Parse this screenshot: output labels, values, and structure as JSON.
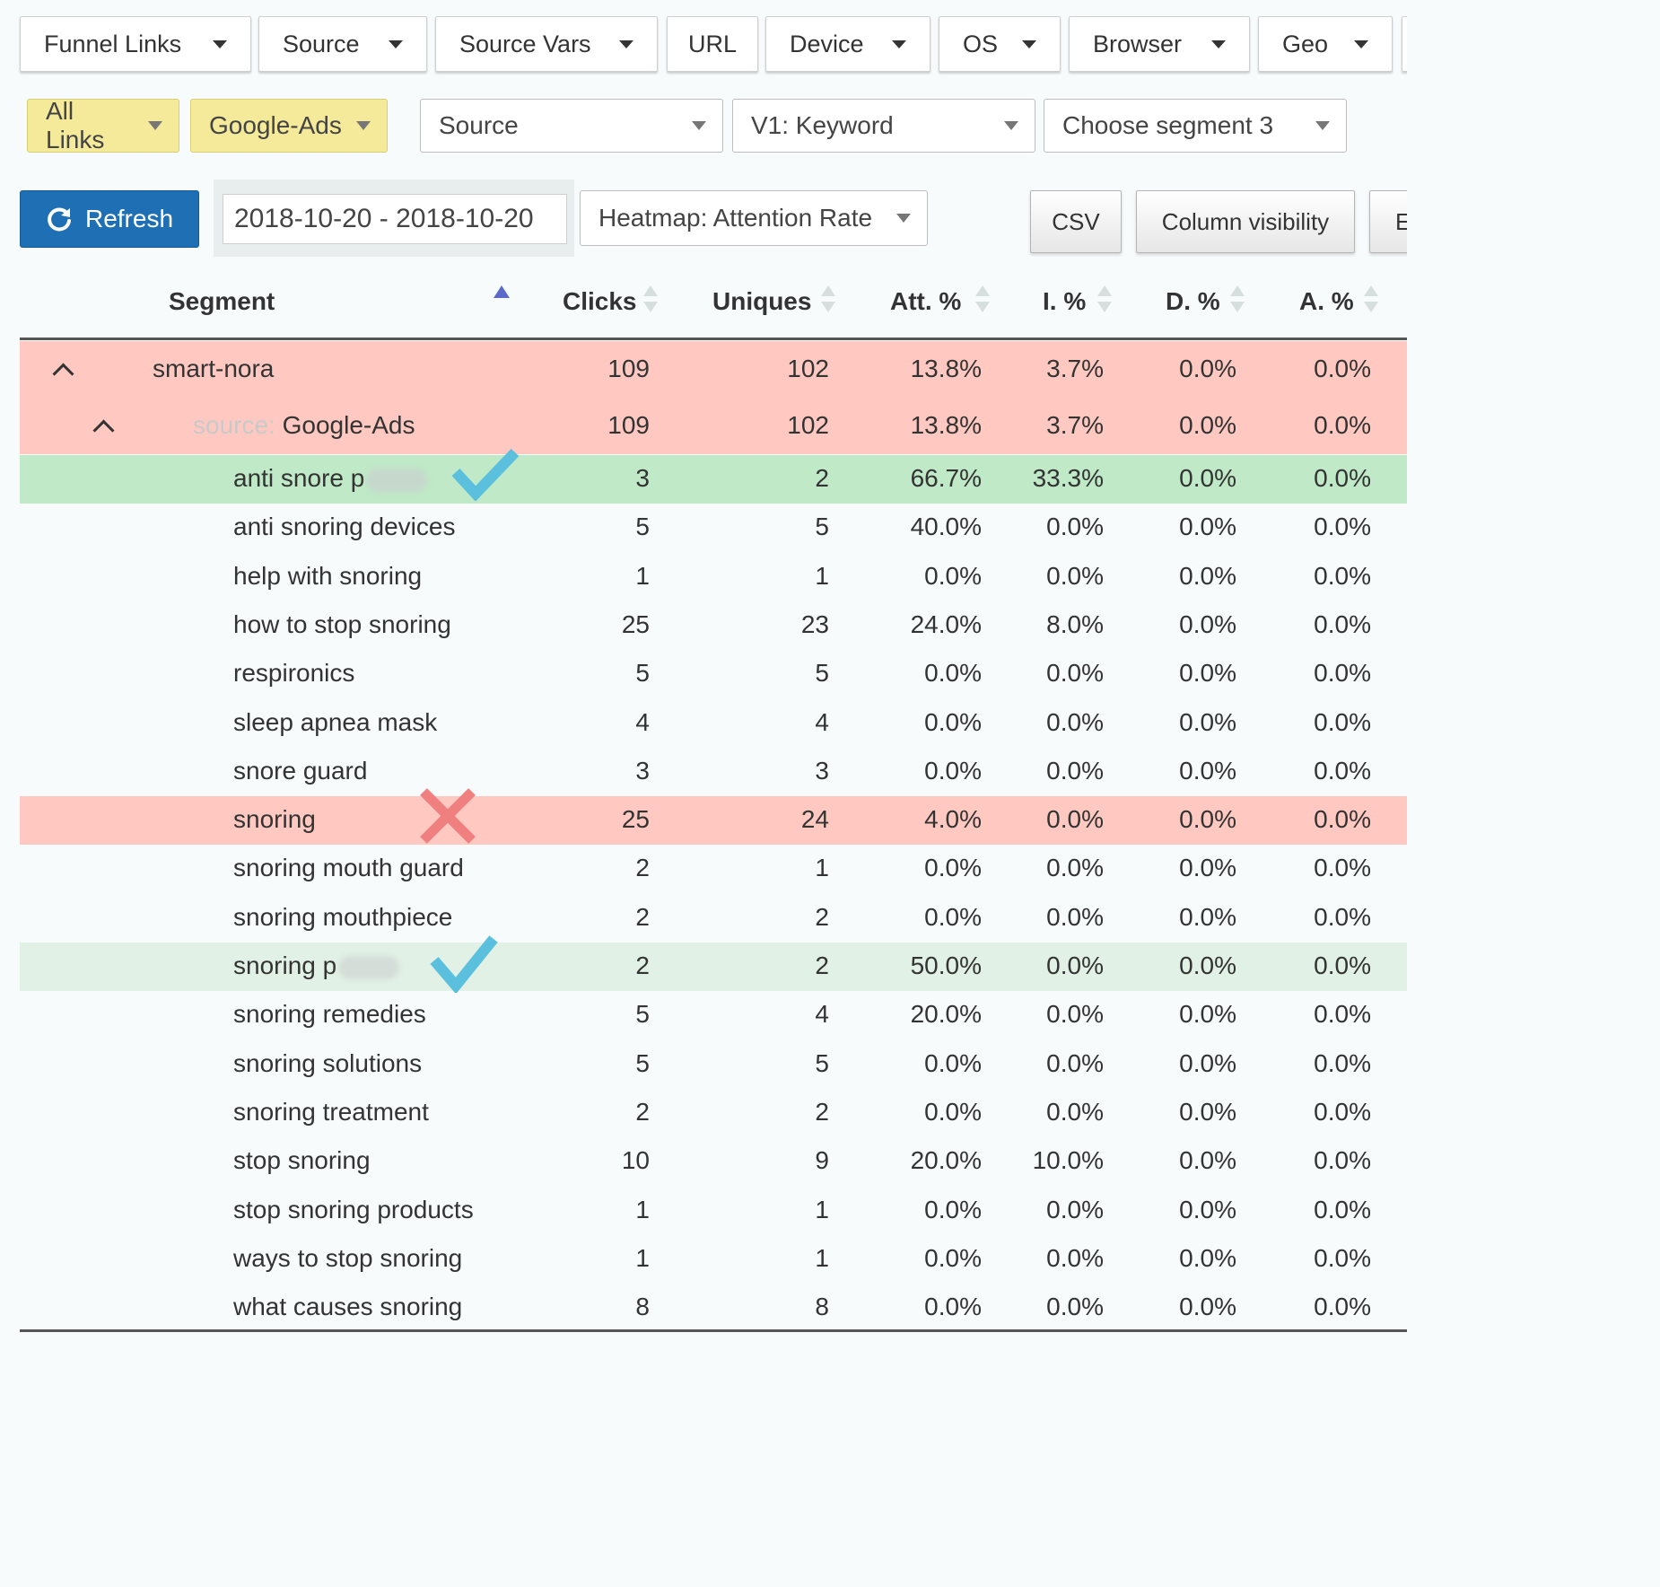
{
  "tabs": [
    {
      "label": "Funnel Links",
      "caret": true
    },
    {
      "label": "Source",
      "caret": true
    },
    {
      "label": "Source Vars",
      "caret": true
    },
    {
      "label": "URL",
      "caret": false
    },
    {
      "label": "Device",
      "caret": true
    },
    {
      "label": "OS",
      "caret": true
    },
    {
      "label": "Browser",
      "caret": true
    },
    {
      "label": "Geo",
      "caret": true
    }
  ],
  "segments": {
    "all_links": "All Links",
    "google_ads": "Google-Ads",
    "segment1": "Source",
    "segment2": "V1: Keyword",
    "segment3": "Choose segment 3"
  },
  "toolbar": {
    "refresh_label": "Refresh",
    "date_range": "2018-10-20 - 2018-10-20",
    "heatmap_label": "Heatmap: Attention Rate",
    "csv_label": "CSV",
    "column_visibility_label": "Column visibility",
    "cut_button_label": "E"
  },
  "table": {
    "columns": [
      "Segment",
      "Clicks",
      "Uniques",
      "Att. %",
      "I. %",
      "D. %",
      "A. %"
    ],
    "group_row": {
      "segment": "smart-nora",
      "clicks": "109",
      "uniques": "102",
      "att": "13.8%",
      "i": "3.7%",
      "d": "0.0%",
      "a": "0.0%"
    },
    "source_row": {
      "prefix": "source:",
      "segment": "Google-Ads",
      "clicks": "109",
      "uniques": "102",
      "att": "13.8%",
      "i": "3.7%",
      "d": "0.0%",
      "a": "0.0%"
    },
    "rows": [
      {
        "segment": "anti snore p",
        "clicks": "3",
        "uniques": "2",
        "att": "66.7%",
        "i": "33.3%",
        "d": "0.0%",
        "a": "0.0%"
      },
      {
        "segment": "anti snoring devices",
        "clicks": "5",
        "uniques": "5",
        "att": "40.0%",
        "i": "0.0%",
        "d": "0.0%",
        "a": "0.0%"
      },
      {
        "segment": "help with snoring",
        "clicks": "1",
        "uniques": "1",
        "att": "0.0%",
        "i": "0.0%",
        "d": "0.0%",
        "a": "0.0%"
      },
      {
        "segment": "how to stop snoring",
        "clicks": "25",
        "uniques": "23",
        "att": "24.0%",
        "i": "8.0%",
        "d": "0.0%",
        "a": "0.0%"
      },
      {
        "segment": "respironics",
        "clicks": "5",
        "uniques": "5",
        "att": "0.0%",
        "i": "0.0%",
        "d": "0.0%",
        "a": "0.0%"
      },
      {
        "segment": "sleep apnea mask",
        "clicks": "4",
        "uniques": "4",
        "att": "0.0%",
        "i": "0.0%",
        "d": "0.0%",
        "a": "0.0%"
      },
      {
        "segment": "snore guard",
        "clicks": "3",
        "uniques": "3",
        "att": "0.0%",
        "i": "0.0%",
        "d": "0.0%",
        "a": "0.0%"
      },
      {
        "segment": "snoring",
        "clicks": "25",
        "uniques": "24",
        "att": "4.0%",
        "i": "0.0%",
        "d": "0.0%",
        "a": "0.0%"
      },
      {
        "segment": "snoring mouth guard",
        "clicks": "2",
        "uniques": "1",
        "att": "0.0%",
        "i": "0.0%",
        "d": "0.0%",
        "a": "0.0%"
      },
      {
        "segment": "snoring mouthpiece",
        "clicks": "2",
        "uniques": "2",
        "att": "0.0%",
        "i": "0.0%",
        "d": "0.0%",
        "a": "0.0%"
      },
      {
        "segment": "snoring p",
        "clicks": "2",
        "uniques": "2",
        "att": "50.0%",
        "i": "0.0%",
        "d": "0.0%",
        "a": "0.0%"
      },
      {
        "segment": "snoring remedies",
        "clicks": "5",
        "uniques": "4",
        "att": "20.0%",
        "i": "0.0%",
        "d": "0.0%",
        "a": "0.0%"
      },
      {
        "segment": "snoring solutions",
        "clicks": "5",
        "uniques": "5",
        "att": "0.0%",
        "i": "0.0%",
        "d": "0.0%",
        "a": "0.0%"
      },
      {
        "segment": "snoring treatment",
        "clicks": "2",
        "uniques": "2",
        "att": "0.0%",
        "i": "0.0%",
        "d": "0.0%",
        "a": "0.0%"
      },
      {
        "segment": "stop snoring",
        "clicks": "10",
        "uniques": "9",
        "att": "20.0%",
        "i": "10.0%",
        "d": "0.0%",
        "a": "0.0%"
      },
      {
        "segment": "stop snoring products",
        "clicks": "1",
        "uniques": "1",
        "att": "0.0%",
        "i": "0.0%",
        "d": "0.0%",
        "a": "0.0%"
      },
      {
        "segment": "ways to stop snoring",
        "clicks": "1",
        "uniques": "1",
        "att": "0.0%",
        "i": "0.0%",
        "d": "0.0%",
        "a": "0.0%"
      },
      {
        "segment": "what causes snoring",
        "clicks": "8",
        "uniques": "8",
        "att": "0.0%",
        "i": "0.0%",
        "d": "0.0%",
        "a": "0.0%"
      }
    ]
  },
  "colors": {
    "heat_high": "#bfe9c7",
    "heat_mid": "#e1f1e5",
    "heat_low": "#ffc9c1",
    "refresh_blue": "#1f6fb5",
    "check_blue": "#5bc0de",
    "cross_red": "#f08080"
  },
  "icons": [
    "refresh-icon",
    "chevron-up-icon",
    "sort-icon",
    "checkmark-icon",
    "cross-icon",
    "caret-down-icon"
  ]
}
